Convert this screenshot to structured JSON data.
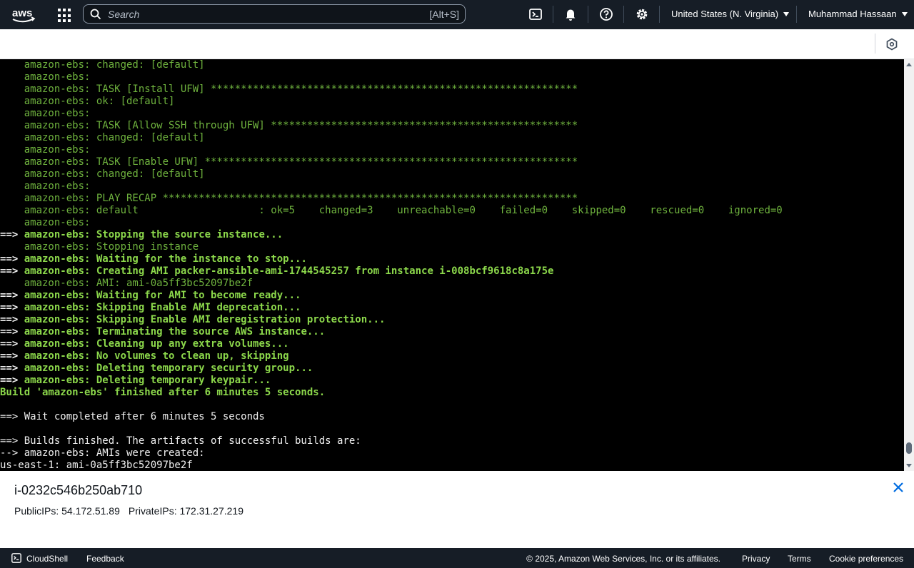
{
  "topnav": {
    "logo": "aws-logo",
    "search_placeholder": "Search",
    "search_shortcut": "[Alt+S]",
    "region": "United States (N. Virginia)",
    "user": "Muhammad Hassaan"
  },
  "terminal": {
    "lines": [
      {
        "t": "    amazon-ebs: changed: [default]",
        "s": "g"
      },
      {
        "t": "    amazon-ebs:",
        "s": "g"
      },
      {
        "t": "    amazon-ebs: TASK [Install UFW] *************************************************************",
        "s": "g"
      },
      {
        "t": "    amazon-ebs: ok: [default]",
        "s": "g"
      },
      {
        "t": "    amazon-ebs:",
        "s": "g"
      },
      {
        "t": "    amazon-ebs: TASK [Allow SSH through UFW] ***************************************************",
        "s": "g"
      },
      {
        "t": "    amazon-ebs: changed: [default]",
        "s": "g"
      },
      {
        "t": "    amazon-ebs:",
        "s": "g"
      },
      {
        "t": "    amazon-ebs: TASK [Enable UFW] **************************************************************",
        "s": "g"
      },
      {
        "t": "    amazon-ebs: changed: [default]",
        "s": "g"
      },
      {
        "t": "    amazon-ebs:",
        "s": "g"
      },
      {
        "t": "    amazon-ebs: PLAY RECAP *********************************************************************",
        "s": "g"
      },
      {
        "t": "    amazon-ebs: default                    : ok=5    changed=3    unreachable=0    failed=0    skipped=0    rescued=0    ignored=0",
        "s": "g"
      },
      {
        "t": "    amazon-ebs:",
        "s": "g"
      },
      {
        "t": "==> amazon-ebs: Stopping the source instance...",
        "s": "b"
      },
      {
        "t": "    amazon-ebs: Stopping instance",
        "s": "g"
      },
      {
        "t": "==> amazon-ebs: Waiting for the instance to stop...",
        "s": "b"
      },
      {
        "t": "==> amazon-ebs: Creating AMI packer-ansible-ami-1744545257 from instance i-008bcf9618c8a175e",
        "s": "b"
      },
      {
        "t": "    amazon-ebs: AMI: ami-0a5ff3bc52097be2f",
        "s": "g"
      },
      {
        "t": "==> amazon-ebs: Waiting for AMI to become ready...",
        "s": "b"
      },
      {
        "t": "==> amazon-ebs: Skipping Enable AMI deprecation...",
        "s": "b"
      },
      {
        "t": "==> amazon-ebs: Skipping Enable AMI deregistration protection...",
        "s": "b"
      },
      {
        "t": "==> amazon-ebs: Terminating the source AWS instance...",
        "s": "b"
      },
      {
        "t": "==> amazon-ebs: Cleaning up any extra volumes...",
        "s": "b"
      },
      {
        "t": "==> amazon-ebs: No volumes to clean up, skipping",
        "s": "b"
      },
      {
        "t": "==> amazon-ebs: Deleting temporary security group...",
        "s": "b"
      },
      {
        "t": "==> amazon-ebs: Deleting temporary keypair...",
        "s": "b"
      },
      {
        "t": "Build 'amazon-ebs' finished after 6 minutes 5 seconds.",
        "s": "b"
      },
      {
        "t": "",
        "s": "w"
      },
      {
        "t": "==> Wait completed after 6 minutes 5 seconds",
        "s": "w"
      },
      {
        "t": "",
        "s": "w"
      },
      {
        "t": "==> Builds finished. The artifacts of successful builds are:",
        "s": "w"
      },
      {
        "t": "--> amazon-ebs: AMIs were created:",
        "s": "w"
      },
      {
        "t": "us-east-1: ami-0a5ff3bc52097be2f",
        "s": "w"
      }
    ]
  },
  "instance": {
    "id": "i-0232c546b250ab710",
    "public_ips": "PublicIPs: 54.172.51.89",
    "private_ips": "PrivateIPs: 172.31.27.219"
  },
  "footer": {
    "cloudshell": "CloudShell",
    "feedback": "Feedback",
    "copyright": "© 2025, Amazon Web Services, Inc. or its affiliates.",
    "privacy": "Privacy",
    "terms": "Terms",
    "cookies": "Cookie preferences"
  },
  "colors": {
    "nav_bg": "#161d26",
    "terminal_bg": "#000000",
    "terminal_green": "#6fb33e",
    "terminal_green_bold": "#8cd84b",
    "terminal_white": "#f0f0f0"
  }
}
